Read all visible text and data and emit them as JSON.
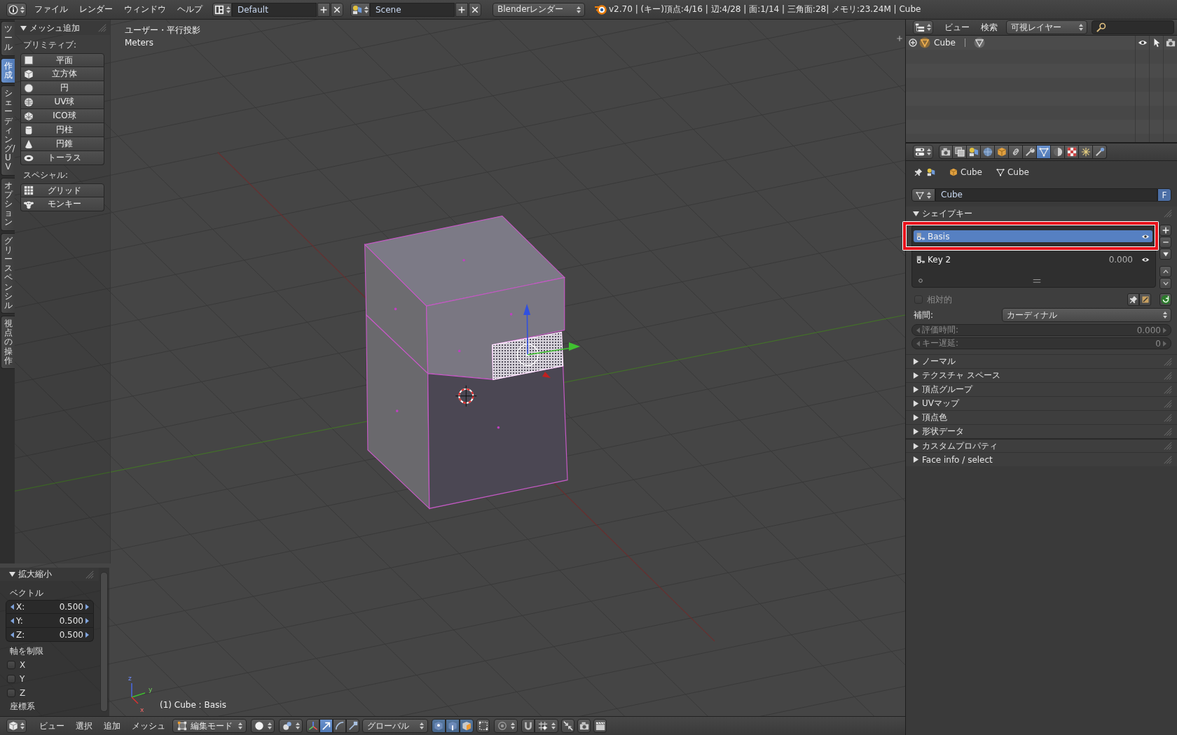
{
  "top_bar": {
    "menus": [
      "ファイル",
      "レンダー",
      "ウィンドウ",
      "ヘルプ"
    ],
    "screen_layout": "Default",
    "scene": "Scene",
    "render_engine": "Blenderレンダー",
    "status": "v2.70 | (キー)頂点:4/16 | 辺:4/28 | 面:1/14 | 三角面:28| メモリ:23.24M | Cube"
  },
  "tool_tabs": [
    {
      "label": "ツール",
      "selected": false
    },
    {
      "label": "作成",
      "selected": true
    },
    {
      "label": "シェーディング/UV",
      "selected": false
    },
    {
      "label": "オプション",
      "selected": false
    },
    {
      "label": "グリースペンシル",
      "selected": false
    },
    {
      "label": "視点の操作",
      "selected": false
    }
  ],
  "add_mesh_panel": {
    "title": "メッシュ追加",
    "expanded": true,
    "groups": [
      {
        "title": "プリミティブ:",
        "buttons": [
          "平面",
          "立方体",
          "円",
          "UV球",
          "ICO球",
          "円柱",
          "円錐",
          "トーラス"
        ]
      },
      {
        "title": "スペシャル:",
        "buttons": [
          "グリッド",
          "モンキー"
        ]
      }
    ]
  },
  "viewport": {
    "view_name": "ユーザー・平行投影",
    "units": "Meters",
    "status": "(1) Cube : Basis",
    "axis_labels": [
      "z",
      "y",
      "x"
    ]
  },
  "scale_panel": {
    "title": "拡大縮小",
    "expanded": true,
    "vector_label": "ベクトル",
    "vector": [
      {
        "axis": "X:",
        "value": "0.500"
      },
      {
        "axis": "Y:",
        "value": "0.500"
      },
      {
        "axis": "Z:",
        "value": "0.500"
      }
    ],
    "constraint_label": "軸を制限",
    "constraints": [
      {
        "label": "X",
        "checked": false
      },
      {
        "label": "Y",
        "checked": false
      },
      {
        "label": "Z",
        "checked": false
      }
    ],
    "orientation_label": "座標系"
  },
  "view3d_header": {
    "menus": [
      "ビュー",
      "選択",
      "追加",
      "メッシュ"
    ],
    "mode": "編集モード",
    "transform_modes": [
      {
        "selected": true
      },
      {
        "selected": false
      },
      {
        "selected": false
      }
    ],
    "orientation": "グローバル"
  },
  "outliner": {
    "menus": [
      "ビュー",
      "検索"
    ],
    "filter": "可視レイヤー",
    "items": [
      {
        "label": "Cube"
      }
    ]
  },
  "properties": {
    "tabs": [
      {
        "selected": false
      },
      {
        "selected": false
      },
      {
        "selected": false
      },
      {
        "selected": false
      },
      {
        "selected": false
      },
      {
        "selected": false
      },
      {
        "selected": false
      },
      {
        "selected": true
      },
      {
        "selected": false
      },
      {
        "selected": false
      },
      {
        "selected": false
      },
      {
        "selected": false
      }
    ],
    "breadcrumb": [
      "Cube",
      "Cube"
    ],
    "datablock": {
      "name": "Cube",
      "fake_user": "F"
    },
    "shape_keys": {
      "title": "シェイプキー",
      "expanded": true,
      "keys": [
        {
          "name": "Basis",
          "selected": true,
          "highlighted": true
        },
        {
          "name": "Key 2",
          "value": "0.000",
          "selected": false,
          "highlighted": false
        }
      ],
      "relative": {
        "label": "相対的",
        "checked": false,
        "disabled": true
      },
      "interpolation_label": "補間:",
      "interpolation": "カーディナル",
      "fields": [
        {
          "label": "評価時間:",
          "value": "0.000",
          "disabled": true
        },
        {
          "label": "キー遅延:",
          "value": "0",
          "disabled": true
        }
      ]
    },
    "panels": [
      {
        "title": "ノーマル",
        "expanded": false
      },
      {
        "title": "テクスチャ スペース",
        "expanded": false
      },
      {
        "title": "頂点グループ",
        "expanded": false
      },
      {
        "title": "UVマップ",
        "expanded": false
      },
      {
        "title": "頂点色",
        "expanded": false
      },
      {
        "title": "形状データ",
        "expanded": false
      },
      {
        "title": "カスタムプロパティ",
        "expanded": false
      },
      {
        "title": "Face info / select",
        "expanded": false
      }
    ]
  }
}
